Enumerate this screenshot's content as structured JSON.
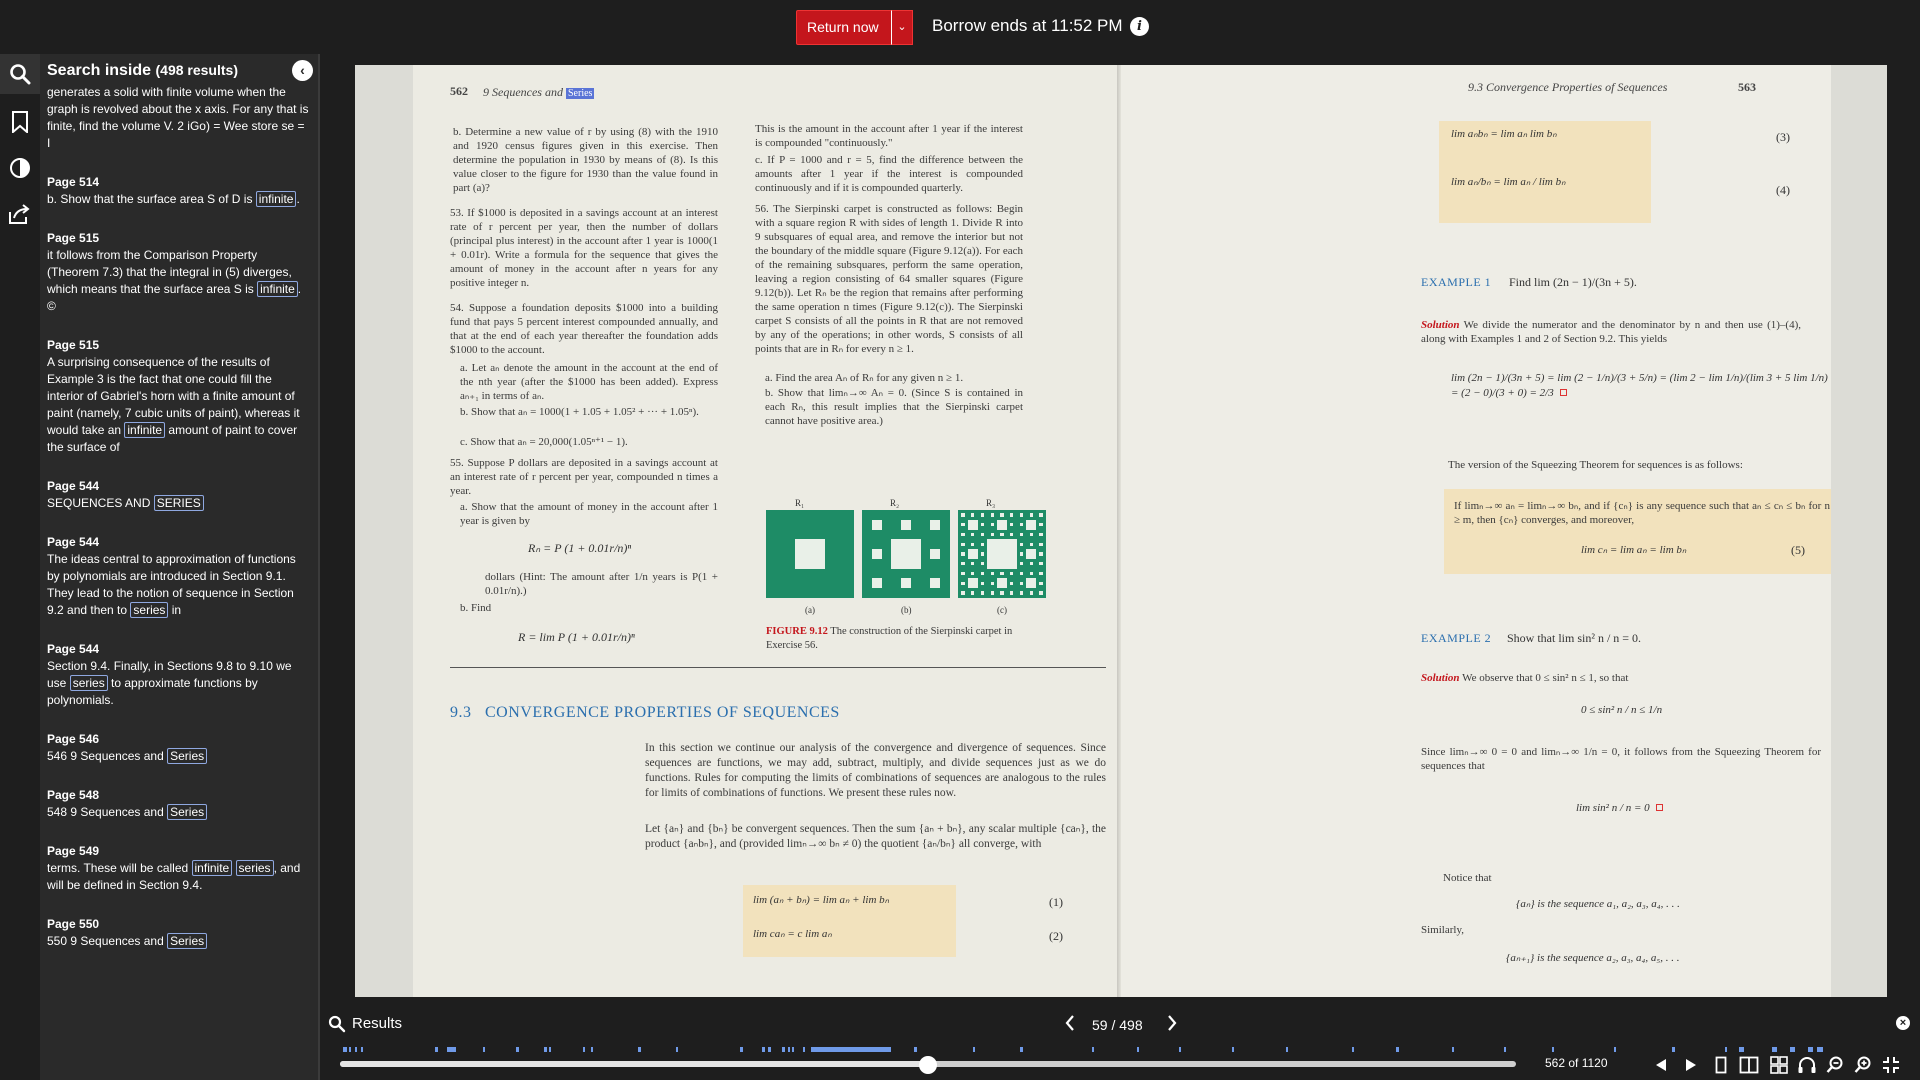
{
  "topbar": {
    "return_label": "Return now",
    "caret": "⌄",
    "borrow_text": "Borrow ends at 11:52 PM",
    "info": "i"
  },
  "panel": {
    "title": "Search inside",
    "count": "(498 results)",
    "results": [
      {
        "page": "",
        "parts": [
          "generates a solid with finite volume when the graph is revolved about the x axis. For any that is finite, find the volume V. 2 iGo) = Wee store se = I"
        ],
        "hl": []
      },
      {
        "page": "Page 514",
        "parts": [
          "b. Show that the surface area S of D is ",
          "infinite",
          "."
        ]
      },
      {
        "page": "Page 515",
        "parts": [
          "it follows from the Comparison Property (Theorem 7.3) that the integral in (5) diverges, which means that the surface area S is ",
          "infinite",
          ". ©"
        ]
      },
      {
        "page": "Page 515",
        "parts": [
          "A surprising consequence of the results of Example 3 is the fact that one could fill the interior of Gabriel's horn with a finite amount of paint (namely, 7 cubic units of paint), whereas it would take an ",
          "infinite",
          " amount of paint to cover the surface of"
        ]
      },
      {
        "page": "Page 544",
        "parts": [
          "SEQUENCES AND ",
          "SERIES",
          ""
        ]
      },
      {
        "page": "Page 544",
        "parts": [
          "The ideas central to approximation of functions by polynomials are introduced in Section 9.1. They lead to the notion of sequence in Section 9.2 and then to ",
          "series",
          " in"
        ]
      },
      {
        "page": "Page 544",
        "parts": [
          "Section 9.4. Finally, in Sections 9.8 to 9.10 we use ",
          "series",
          " to approximate functions by polynomials."
        ]
      },
      {
        "page": "Page 546",
        "parts": [
          "546 9 Sequences and ",
          "Series",
          ""
        ]
      },
      {
        "page": "Page 548",
        "parts": [
          "548 9 Sequences and ",
          "Series",
          ""
        ]
      },
      {
        "page": "Page 549",
        "parts": [
          "terms. These will be called ",
          "infinite",
          " ",
          "series",
          ", and will be defined in Section 9.4."
        ]
      },
      {
        "page": "Page 550",
        "parts": [
          "550 9 Sequences and ",
          "Series",
          ""
        ]
      }
    ]
  },
  "book": {
    "left_page_number": "562",
    "left_header": "9   Sequences and",
    "left_header_hl": "Series",
    "right_header": "9.3   Convergence Properties of Sequences",
    "right_page_number": "563",
    "ex_b": "b. Determine a new value of r by using (8) with the 1910 and 1920 census figures given in this exercise. Then determine the population in 1930 by means of (8). Is this value closer to the figure for 1930 than the value found in part (a)?",
    "ex_53": "53. If $1000 is deposited in a savings account at an interest rate of r percent per year, then the number of dollars (principal plus interest) in the account after 1 year is 1000(1 + 0.01r). Write a formula for the sequence that gives the amount of money in the account after n years for any positive integer n.",
    "ex_54": "54. Suppose a foundation deposits $1000 into a building fund that pays 5 percent interest compounded annually, and that at the end of each year thereafter the foundation adds $1000 to the account.",
    "ex_54a": "a. Let aₙ denote the amount in the account at the end of the nth year (after the $1000 has been added). Express aₙ₊₁ in terms of aₙ.",
    "ex_54b": "b. Show that aₙ = 1000(1 + 1.05 + 1.05² + ··· + 1.05ⁿ).",
    "ex_54c": "c. Show that aₙ = 20,000(1.05ⁿ⁺¹ − 1).",
    "ex_55": "55. Suppose P dollars are deposited in a savings account at an interest rate of r percent per year, compounded n times a year.",
    "ex_55a": "a. Show that the amount of money in the account after 1 year is given by",
    "ex_55eq": "Rₙ = P (1 + 0.01r/n)ⁿ",
    "ex_55hint": "dollars (Hint: The amount after 1/n years is P(1 + 0.01r/n).)",
    "ex_55b": "b. Find",
    "ex_55beq": "R = lim P (1 + 0.01r/n)ⁿ",
    "col2_top": "This is the amount in the account after 1 year if the interest is compounded \"continuously.\"",
    "col2_c": "c. If P = 1000 and r = 5, find the difference between the amounts after 1 year if the interest is compounded continuously and if it is compounded quarterly.",
    "ex_56": "56. The Sierpinski carpet is constructed as follows: Begin with a square region R with sides of length 1. Divide R into 9 subsquares of equal area, and remove the interior but not the boundary of the middle square (Figure 9.12(a)). For each of the remaining subsquares, perform the same operation, leaving a region consisting of 64 smaller squares (Figure 9.12(b)). Let Rₙ be the region that remains after performing the same operation n times (Figure 9.12(c)). The Sierpinski carpet S consists of all the points in R that are not removed by any of the operations; in other words, S consists of all points that are in Rₙ for every n ≥ 1.",
    "ex_56a": "a. Find the area Aₙ of Rₙ for any given n ≥ 1.",
    "ex_56b": "b. Show that limₙ→∞ Aₙ = 0. (Since S is contained in each Rₙ, this result implies that the Sierpinski carpet cannot have positive area.)",
    "fig_labels_top": [
      "R₁",
      "R₂",
      "R₃"
    ],
    "fig_labels_bottom": [
      "(a)",
      "(b)",
      "(c)"
    ],
    "fig_caption_label": "FIGURE 9.12",
    "fig_caption": "The construction of the Sierpinski carpet in Exercise 56.",
    "section_number": "9.3",
    "section_title": "CONVERGENCE PROPERTIES OF SEQUENCES",
    "section_p1": "In this section we continue our analysis of the convergence and divergence of sequences. Since sequences are functions, we may add, subtract, multiply, and divide sequences just as we do functions. Rules for computing the limits of combinations of sequences are analogous to the rules for limits of combinations of functions. We present these rules now.",
    "section_p2": "Let {aₙ} and {bₙ} be convergent sequences. Then the sum {aₙ + bₙ}, any scalar multiple {caₙ}, the product {aₙbₙ}, and (provided limₙ→∞ bₙ ≠ 0) the quotient {aₙ/bₙ} all converge, with",
    "eq1": "lim (aₙ + bₙ) = lim aₙ + lim bₙ",
    "eq1_num": "(1)",
    "eq2": "lim caₙ = c lim aₙ",
    "eq2_num": "(2)",
    "eq3": "lim aₙbₙ = lim aₙ lim bₙ",
    "eq3_num": "(3)",
    "eq4": "lim aₙ/bₙ = lim aₙ / lim bₙ",
    "eq4_num": "(4)",
    "example1_label": "EXAMPLE 1",
    "example1_text": "Find lim (2n − 1)/(3n + 5).",
    "solution_label": "Solution",
    "solution1_text": "We divide the numerator and the denominator by n and then use (1)–(4), along with Examples 1 and 2 of Section 9.2. This yields",
    "solution1_eq": "lim (2n − 1)/(3n + 5) = lim (2 − 1/n)/(3 + 5/n) = (lim 2 − lim 1/n)/(lim 3 + 5 lim 1/n) = (2 − 0)/(3 + 0) = 2/3",
    "squeeze_intro": "The version of the Squeezing Theorem for sequences is as follows:",
    "squeeze_box": "If limₙ→∞ aₙ = limₙ→∞ bₙ, and if {cₙ} is any sequence such that aₙ ≤ cₙ ≤ bₙ for n ≥ m, then {cₙ} converges, and moreover,",
    "squeeze_eq": "lim cₙ = lim aₙ = lim bₙ",
    "eq5_num": "(5)",
    "example2_label": "EXAMPLE 2",
    "example2_text": "Show that lim sin² n / n = 0.",
    "solution2_text": "We observe that 0 ≤ sin² n ≤ 1, so that",
    "solution2_eq": "0 ≤ sin² n / n ≤ 1/n",
    "since_text": "Since limₙ→∞ 0 = 0 and limₙ→∞ 1/n = 0, it follows from the Squeezing Theorem for sequences that",
    "since_eq": "lim sin² n / n = 0",
    "notice": "Notice that",
    "notice_eq": "{aₙ} is the sequence a₁, a₂, a₃, a₄, . . .",
    "similarly": "Similarly,",
    "similarly_eq": "{aₙ₊₁} is the sequence a₂, a₃, a₄, a₅, . . ."
  },
  "bottom": {
    "results_label": "Results",
    "counter": "59 / 498",
    "page_of": "562 of 1120",
    "progress_fraction": 0.5,
    "close": "×"
  },
  "colors": {
    "return_button": "#c4161c",
    "highlight_border": "#8fa8e0",
    "hit_marker": "#6f9ae8",
    "fig_green": "#1e8c66",
    "box_beige": "#f2e2bd",
    "heading_blue": "#2b6fae"
  },
  "icons": {
    "rail": [
      "search-icon",
      "bookmark-icon",
      "contrast-icon",
      "share-icon"
    ],
    "toolbar": [
      "prev-page-icon",
      "next-page-icon",
      "single-page-icon",
      "two-page-icon",
      "thumbnail-grid-icon",
      "read-aloud-icon",
      "zoom-out-icon",
      "zoom-in-icon",
      "fullscreen-exit-icon"
    ]
  }
}
